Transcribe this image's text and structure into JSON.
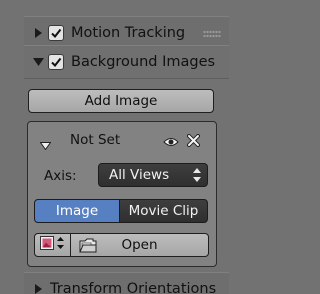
{
  "panels": {
    "motion_tracking": {
      "label": "Motion Tracking",
      "checked": true,
      "expanded": false
    },
    "background_images": {
      "label": "Background Images",
      "checked": true,
      "expanded": true
    },
    "transform_orientations": {
      "label": "Transform Orientations",
      "expanded": false
    }
  },
  "add_image_button": {
    "label": "Add Image"
  },
  "image_entry": {
    "name": "Not Set",
    "icons": {
      "visibility": "eye-icon",
      "remove": "close-icon"
    },
    "axis": {
      "label": "Axis:",
      "value": "All Views"
    },
    "source_tabs": [
      {
        "label": "Image",
        "active": true
      },
      {
        "label": "Movie Clip",
        "active": false
      }
    ],
    "open_button": {
      "label": "Open"
    }
  },
  "colors": {
    "accent": "#5680c2",
    "panel_bg": "#727272",
    "box_bg": "#828282",
    "select_bg": "#353535"
  }
}
